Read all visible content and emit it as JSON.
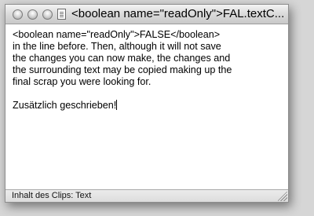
{
  "window": {
    "title": "<boolean name=\"readOnly\">FAL.textC..."
  },
  "content": {
    "text": "<boolean name=\"readOnly\">FALSE</boolean>\nin the line before. Then, although it will not save\nthe changes you can now make, the changes and\nthe surrounding text may be copied making up the\nfinal scrap you were looking for.\n\nZusätzlich geschrieben!"
  },
  "statusbar": {
    "text": "Inhalt des Clips: Text"
  },
  "icons": {
    "close": "close-button-icon",
    "minimize": "minimize-button-icon",
    "zoom": "zoom-button-icon",
    "document": "document-proxy-icon",
    "resize": "resize-grip-icon"
  }
}
